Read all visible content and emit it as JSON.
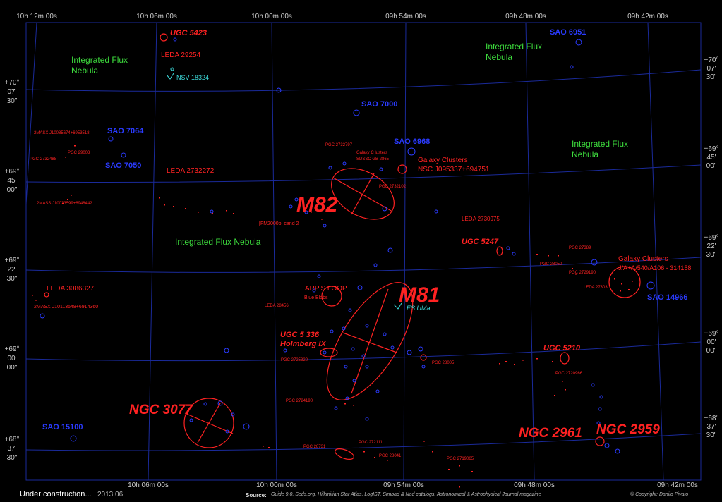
{
  "map": {
    "ra_top": [
      "10h 12m 00s",
      "10h 06m 00s",
      "10h 00m 00s",
      "09h 54m 00s",
      "09h 48m 00s",
      "09h 42m 00s"
    ],
    "ra_bottom": [
      "10h 06m 00s",
      "10h 00m 00s",
      "09h 54m 00s",
      "09h 48m 00s",
      "09h 42m 00s"
    ],
    "dec_left": [
      [
        "+70°",
        "07'",
        "30\""
      ],
      [
        "+69°",
        "45'",
        "00\""
      ],
      [
        "+69°",
        "22'",
        "30\""
      ],
      [
        "+69°",
        "00'",
        "00\""
      ],
      [
        "+68°",
        "37'",
        "30\""
      ]
    ],
    "dec_right": [
      [
        "+70°",
        "07'",
        "30\""
      ],
      [
        "+69°",
        "45'",
        "00\""
      ],
      [
        "+69°",
        "22'",
        "30\""
      ],
      [
        "+69°",
        "00'",
        "00\""
      ],
      [
        "+68°",
        "37'",
        "30\""
      ]
    ],
    "big_labels": {
      "m82": "M82",
      "m81": "M81",
      "ngc3077": "NGC 3077",
      "ngc2961": "NGC 2961",
      "ngc2959": "NGC 2959"
    },
    "galaxy_labels": {
      "ugc5423": "UGC 5423",
      "leda29254": "LEDA 29254",
      "ugc5247": "UGC 5247",
      "ugc5336": "UGC 5 336",
      "holmberg": "Holmberg IX",
      "ugc5210": "UGC 5210"
    },
    "red_labels": {
      "leda2732272": "LEDA 2732272",
      "leda3086327": "LEDA 3086327",
      "arps_loop": "ARP'S LOOP",
      "blue_blobs": "Blue Blobs",
      "gc1": "Galaxy Clusters",
      "gc1b": "NSC J095337+694751",
      "gc2": "Galaxy Clusters",
      "gc2b": "J/A+A/540/A106 - 314158",
      "leda2730975": "LEDA 2730975",
      "fm2000": "[FM2000b] cand 2",
      "pgc2732797": "PGC 2732797",
      "galaxy_cluster_small": "Galaxy C lusters",
      "sdss": "SDSSC GB 2865",
      "pgc2732102": "PGC 2732102",
      "twomass1": "2MASX J10085674+6953518",
      "pgc29003": "PGC 29003",
      "pgc2732488": "PGC 2732488",
      "twomass2": "2MASX J10113548+6914360",
      "tiny1": "2MASS J10033599+6948442",
      "pgc27389": "PGC 27389",
      "pgc28050": "PGC 28050",
      "pgc2729190": "PGC 2729190",
      "leda2730": "LEDA 27303",
      "leda28456": "LEDA 28456",
      "pgc2725320": "PGC 2725320",
      "pgc28005": "PGC 28005",
      "pgc2720966": "PGC 2720966",
      "pgc2724190": "PGC 2724190",
      "pgc28731": "PGC 28731",
      "pgc272111": "PGC 272111",
      "pgc28041": "PGC 28041",
      "pgc2719065": "PGC 2719065"
    },
    "star_labels": {
      "sao6951": "SAO 6951",
      "sao7000": "SAO 7000",
      "sao6968": "SAO 6968",
      "sao7064": "SAO 7064",
      "sao7050": "SAO 7050",
      "sao14966": "SAO 14966",
      "sao15100": "SAO 15100"
    },
    "nebula_labels": {
      "n1a": "Integrated Flux",
      "n1b": "Nebula",
      "n2a": "Integrated Flux",
      "n2b": "Nebula",
      "n3a": "Integrated Flux",
      "n3b": "Nebula",
      "n4": "Integrated Flux Nebula"
    },
    "variable_labels": {
      "nsv": "NSV 18324",
      "esuma": "ES UMa"
    },
    "colors": {
      "grid": "#1a2a9a",
      "galaxy": "#ff2222",
      "star": "#2a3bff",
      "nebula": "#3ddc3d",
      "variable": "#3ddcdc"
    }
  },
  "footer": {
    "status": "Under construction...",
    "year": "2013.06",
    "source_label": "Source:",
    "source_text": "Guide 9.0, Seds.org, Hilkmitian Star Atlas, LogIST, Simbad & Ned catalogs, Astronomical & Astrophysical Journal magazine",
    "copyright": "© Copyright: Danilo Pivato"
  }
}
